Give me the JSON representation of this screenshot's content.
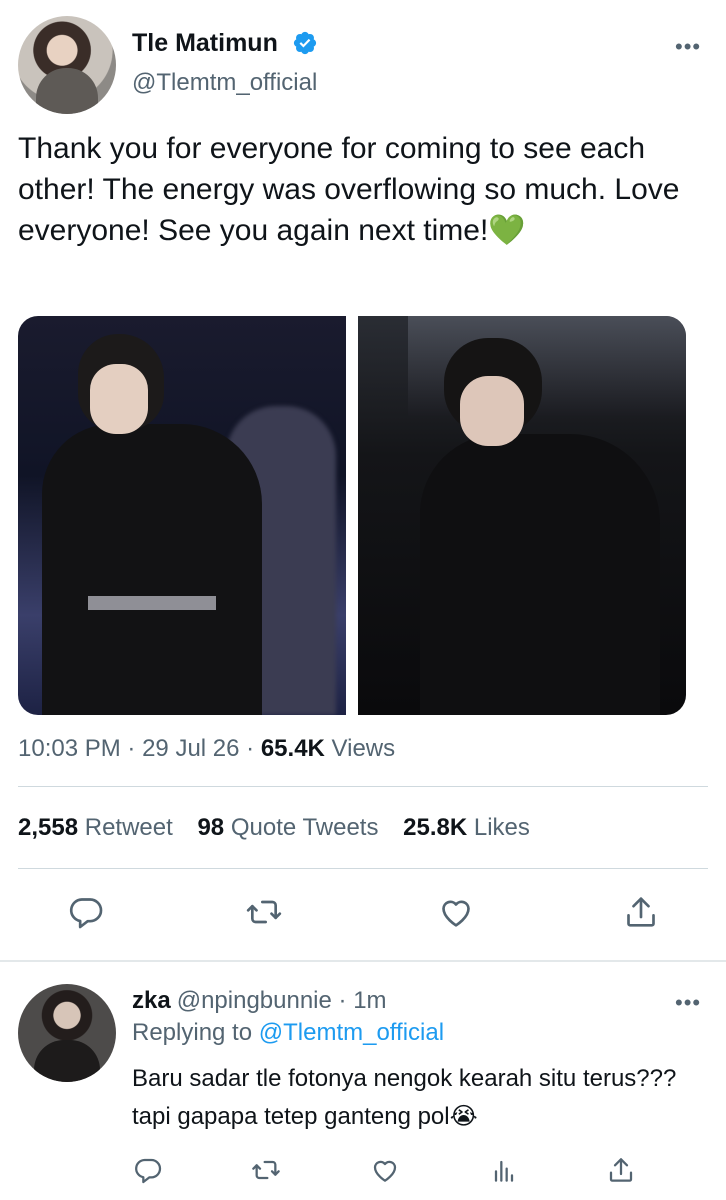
{
  "tweet": {
    "display_name": "Tle Matimun",
    "handle": "@Tlemtm_official",
    "text": "Thank you for everyone for coming to see each other! The energy was overflowing so much. Love everyone! See you again next time!💚",
    "time": "10:03 PM",
    "date": "29 Jul 26",
    "views_count": "65.4K",
    "views_label": "Views",
    "separator": "·",
    "stats": {
      "retweets_count": "2,558",
      "retweets_label": "Retweet",
      "quotes_count": "98",
      "quotes_label": "Quote Tweets",
      "likes_count": "25.8K",
      "likes_label": "Likes"
    },
    "more_label": "•••"
  },
  "reply": {
    "display_name": "zka",
    "handle": "@npingbunnie",
    "separator": "·",
    "time": "1m",
    "replying_prefix": "Replying to",
    "replying_handle": "@Tlemtm_official",
    "text": "Baru sadar tle fotonya nengok kearah situ terus??? tapi gapapa tetep ganteng pol😭",
    "more_label": "•••"
  },
  "icons": {
    "verified": "verified-badge-icon",
    "reply": "reply-icon",
    "retweet": "retweet-icon",
    "like": "heart-icon",
    "share": "share-icon",
    "analytics": "analytics-icon"
  },
  "colors": {
    "accent": "#1d9bf0",
    "secondary_text": "#536471",
    "primary_text": "#0f1419",
    "divider": "#cfd9de"
  }
}
